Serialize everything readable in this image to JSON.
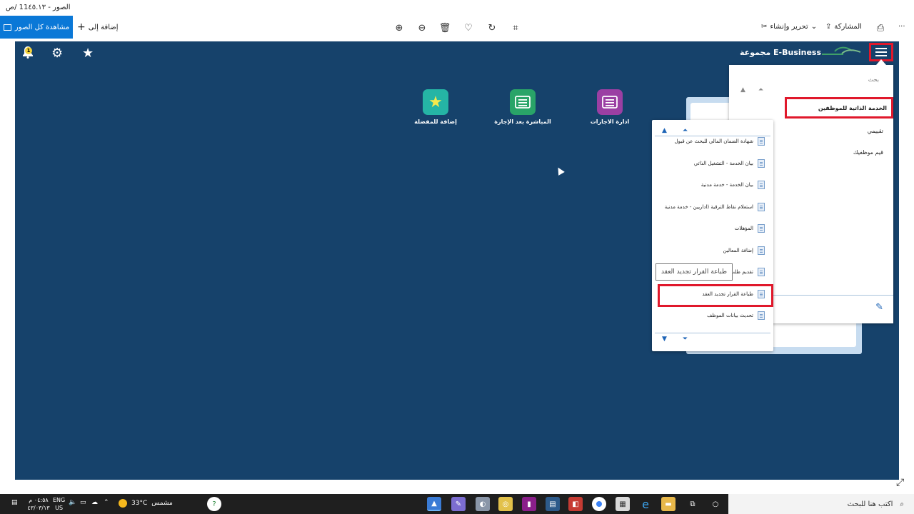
{
  "window": {
    "title": "الصور - 11٤٥.١٣ /ص"
  },
  "toolbar": {
    "view_all_label": "مشاهدة كل الصور",
    "add_to_label": "إضافة إلى",
    "edit_create_label": "تحرير وإنشاء",
    "share_label": "المشاركة",
    "more_label": "···"
  },
  "app": {
    "notification_count": "1",
    "brand_name": "مجموعة E-Business",
    "tiles": [
      {
        "label": "إضافة للمفضلة",
        "color": "#25b5a5"
      },
      {
        "label": "المباشرة بعد الإجازة",
        "color": "#29a468"
      },
      {
        "label": "ادارة الاجازات",
        "color": "#9b3fa3"
      }
    ],
    "nav": {
      "search_placeholder": "بحث",
      "selected_item": "الخدمة الذاتية للموظفين",
      "items": [
        "تقييمي",
        "قيم موظفيك"
      ]
    },
    "submenu": {
      "items": [
        "شهادة الضمان المالي للبحث عن قبول",
        "بيان الخدمة - التشغيل الذاتي",
        "بيان الخدمة - خدمة مدنية",
        "استعلام نقاط الترقية (اداريين - خدمة مدنية",
        "المؤهلات",
        "إضافة المعالين",
        "تقديم طلب",
        "طباعة القرار تجديد العقد",
        "تحديث بيانات الموظف"
      ],
      "tooltip": "طباعة القرار تجديد العقد"
    }
  },
  "taskbar": {
    "search_placeholder": "اكتب هنا للبحث",
    "weather": "مشمس",
    "temperature": "33°C",
    "language": "ENG",
    "region": "US",
    "time": "٠٤:٥٨ م",
    "date": "٤٣/٠٣/١٣"
  },
  "colors": {
    "app_background": "#16426b",
    "highlight_red": "#e0182b",
    "accent_blue": "#0a78d7"
  }
}
